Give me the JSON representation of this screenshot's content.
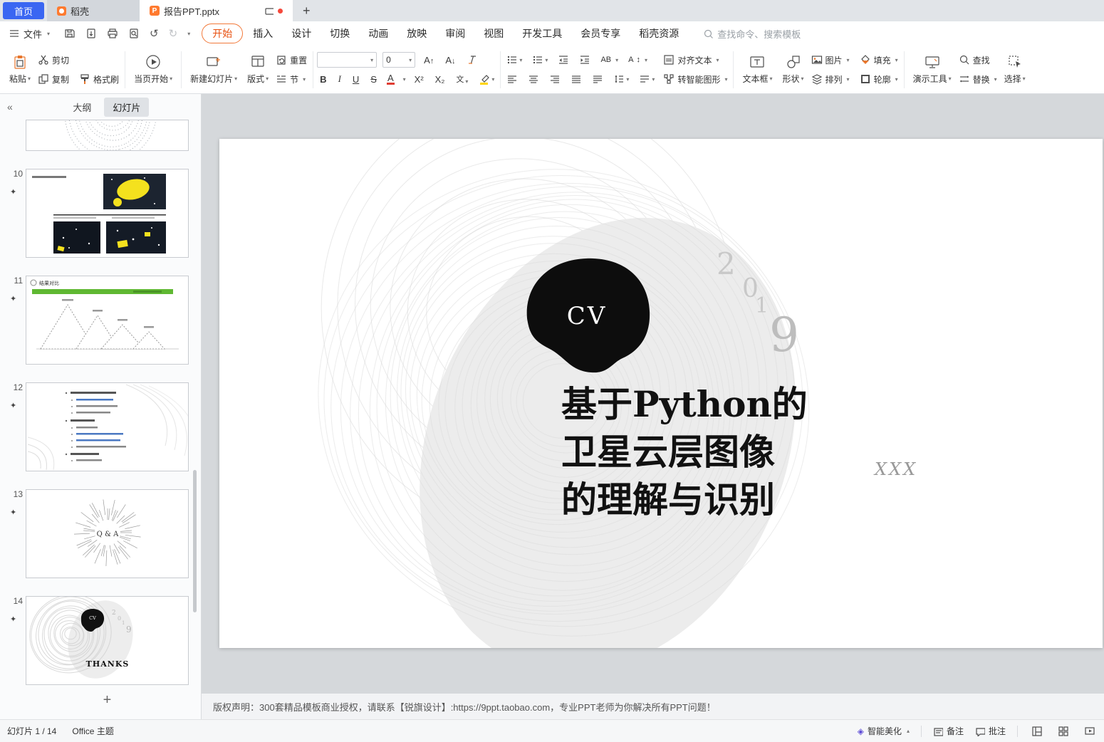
{
  "tabbar": {
    "home_label": "首页",
    "daoke_tab": "稻壳",
    "doc_tab": "报告PPT.pptx",
    "new_tab": "+"
  },
  "menubar": {
    "file_label": "文件",
    "tabs": [
      "开始",
      "插入",
      "设计",
      "切换",
      "动画",
      "放映",
      "审阅",
      "视图",
      "开发工具",
      "会员专享",
      "稻壳资源"
    ],
    "search_placeholder": "查找命令、搜索模板"
  },
  "ribbon": {
    "paste": "粘贴",
    "cut": "剪切",
    "copy": "复制",
    "format_painter": "格式刷",
    "play_current": "当页开始",
    "new_slide": "新建幻灯片",
    "layout": "版式",
    "reset": "重置",
    "section": "节",
    "font_size": "0",
    "bold": "B",
    "italic": "I",
    "underline": "U",
    "strike": "S",
    "font_color": "A",
    "sup": "X²",
    "sub": "X₂",
    "pinyin": "文",
    "text_dir": "AB",
    "align_text": "对齐文本",
    "smart_graphic": "转智能图形",
    "textbox": "文本框",
    "shape": "形状",
    "picture": "图片",
    "fill": "填充",
    "arrange": "排列",
    "outline": "轮廓",
    "present_tools": "演示工具",
    "find": "查找",
    "replace": "替换",
    "select": "选择"
  },
  "sidebar": {
    "collapse": "«",
    "tab_outline": "大纲",
    "tab_slides": "幻灯片",
    "slides": [
      {
        "num": "10"
      },
      {
        "num": "11",
        "title": "结果对比"
      },
      {
        "num": "12"
      },
      {
        "num": "13",
        "title": "Q & A"
      },
      {
        "num": "14",
        "title": "THANKS",
        "badge": "CV"
      }
    ],
    "star": "✦",
    "add_slide": "+"
  },
  "slide": {
    "badge": "CV",
    "year_d1": "2",
    "year_d2": "0",
    "year_d3": "1",
    "year_d4": "9",
    "title_line1": "基于Python的",
    "title_line2": "卫星云层图像",
    "title_line3": "的理解与识别",
    "author": "XXX"
  },
  "copyright_text": "版权声明：300套精品模板商业授权，请联系【锐旗设计】:https://9ppt.taobao.com，专业PPT老师为你解决所有PPT问题！",
  "statusbar": {
    "slide_counter": "幻灯片 1 / 14",
    "theme": "Office 主题",
    "beautify": "智能美化",
    "notes": "备注",
    "comments": "批注"
  }
}
